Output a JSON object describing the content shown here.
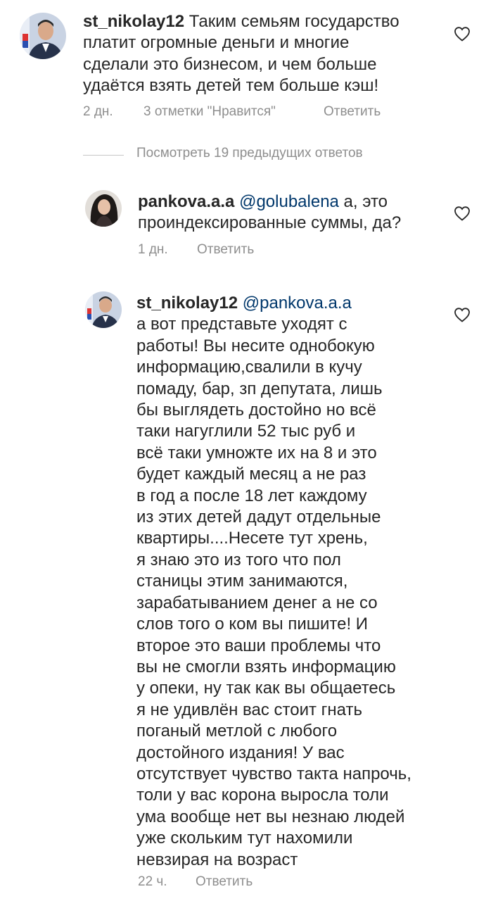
{
  "comments": [
    {
      "username": "st_nikolay12",
      "mention": "",
      "lines": [
        "Таким семьям государство",
        "платит огромные деньги и многие",
        "сделали это бизнесом, и чем больше",
        "удаётся взять детей тем больше кэш!"
      ],
      "time": "2 дн.",
      "likes": "3 отметки \"Нравится\"",
      "reply": "Ответить"
    },
    {
      "username": "pankova.a.a",
      "mention": "@golubalena",
      "first_line_rest": " а, это",
      "lines": [
        "проиндексированные суммы, да?"
      ],
      "time": "1 дн.",
      "reply": "Ответить"
    },
    {
      "username": "st_nikolay12",
      "mention": "@pankova.a.a",
      "lines": [
        "а вот представьте уходят с",
        "работы! Вы несите однобокую",
        "информацию,свалили в кучу",
        "помаду, бар, зп депутата, лишь",
        "бы выглядеть достойно но всё",
        "таки нагуглили 52 тыс руб и",
        "всё таки умножте их на 8 и это",
        "будет каждый месяц а не раз",
        "в год а после 18 лет каждому",
        "из этих детей дадут отдельные",
        "квартиры....Несете тут хрень,",
        "я знаю это из того что пол",
        "станицы этим занимаются,",
        "зарабатыванием денег а не со",
        "слов того о ком вы пишите!  И",
        "второе это ваши проблемы что",
        "вы не смогли взять информацию",
        "у опеки,  ну так как вы общаетесь",
        "я не удивлён вас стоит гнать",
        "поганый метлой с любого",
        "достойного издания!  У вас",
        "отсутствует чувство такта напрочь,",
        "толи у вас корона выросла толи",
        "ума вообще нет вы незнаю людей",
        "уже скольким тут нахомили",
        "невзирая на возраст"
      ],
      "time": "22 ч.",
      "reply": "Ответить"
    }
  ],
  "view_replies": "Посмотреть 19 предыдущих ответов",
  "colors": {
    "text": "#262626",
    "secondary": "#8e8e8e",
    "mention": "#00376b"
  },
  "icons": {
    "like": "heart-outline-icon"
  }
}
